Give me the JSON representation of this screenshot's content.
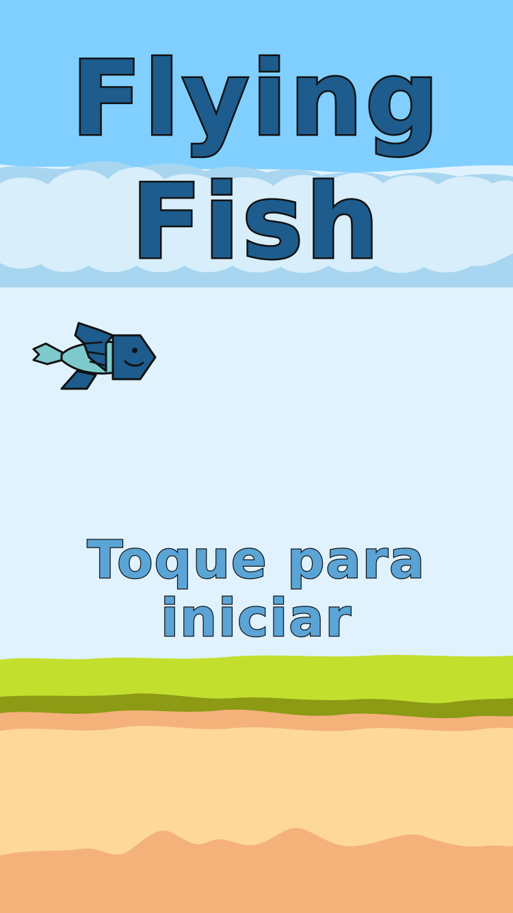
{
  "game": {
    "title_line1": "Flying",
    "title_line2": "Fish",
    "tap_line1": "Toque para",
    "tap_line2": "iniciar"
  },
  "colors": {
    "sky_top": "#80cfff",
    "sky_light": "#e0f2fd",
    "cloud": "#d8eefb",
    "cloud_shadow": "#a8d6f0",
    "title": "#1d5c8c",
    "prompt": "#5ba4d6",
    "fish_body": "#1d5c8c",
    "fish_belly": "#7ec9cc",
    "grass": "#c2df2e",
    "grass_dark": "#8c9a14",
    "sand_top": "#f4b27a",
    "sand": "#fdd899",
    "sand_bottom": "#f4b27a"
  },
  "icons": {
    "player": "fish-icon"
  }
}
